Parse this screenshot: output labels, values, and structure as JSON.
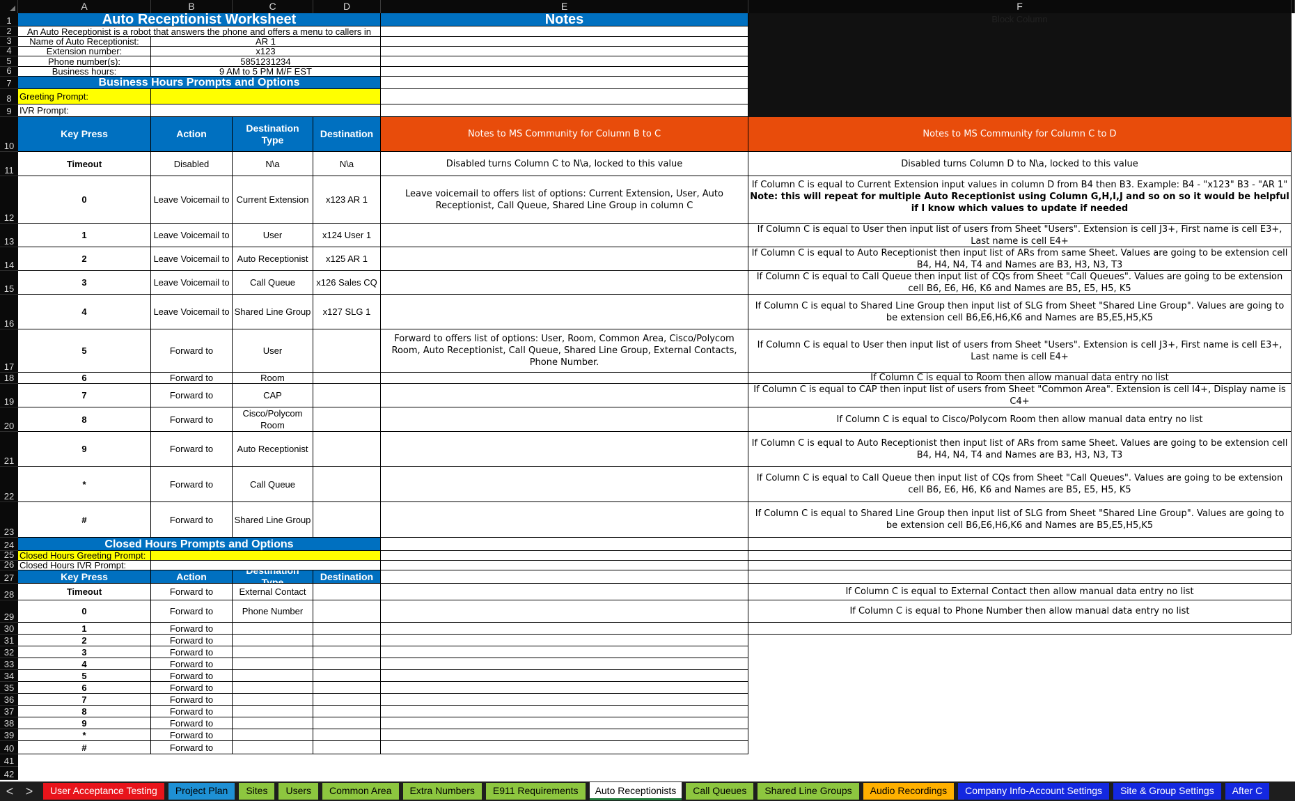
{
  "columns": [
    "A",
    "B",
    "C",
    "D",
    "E",
    "F"
  ],
  "rows": [
    "1",
    "2",
    "3",
    "4",
    "5",
    "6",
    "7",
    "8",
    "9",
    "10",
    "11",
    "12",
    "13",
    "14",
    "15",
    "16",
    "17",
    "18",
    "19",
    "20",
    "21",
    "22",
    "23",
    "24",
    "25",
    "26",
    "27",
    "28",
    "29",
    "30",
    "31",
    "32",
    "33",
    "34",
    "35",
    "36",
    "37",
    "38",
    "39",
    "40",
    "41",
    "42"
  ],
  "header": {
    "title": "Auto Receptionist Worksheet",
    "notes_title": "Notes",
    "block_column": "Block Column",
    "description": "An Auto Receptionist is a robot that answers the phone and offers a menu to callers in"
  },
  "info": [
    {
      "label": "Name of Auto Receptionist:",
      "value": "AR 1"
    },
    {
      "label": "Extension number:",
      "value": "x123"
    },
    {
      "label": "Phone number(s):",
      "value": "5851231234"
    },
    {
      "label": "Business hours:",
      "value": "9 AM to 5 PM M/F EST"
    }
  ],
  "business": {
    "section_title": "Business Hours Prompts and Options",
    "greeting_label": "Greeting Prompt:",
    "ivr_label": "IVR Prompt:",
    "col_key": "Key Press",
    "col_action": "Action",
    "col_dest_type": "Destination Type",
    "col_dest": "Destination",
    "notes_bc": "Notes to MS Community for Column B to C",
    "notes_cd": "Notes to MS Community for Column C to D",
    "rows": [
      {
        "key": "Timeout",
        "action": "Disabled",
        "type": "N\\a",
        "dest": "N\\a",
        "note_e": "Disabled turns Column C to N\\a, locked to this value",
        "note_f": "Disabled turns Column D to N\\a, locked to this value",
        "note_f_bold": ""
      },
      {
        "key": "0",
        "action": "Leave Voicemail to",
        "type": "Current Extension",
        "dest": "x123 AR 1",
        "note_e": "Leave voicemail to offers list of options: Current Extension, User, Auto Receptionist, Call Queue, Shared Line Group in column C",
        "note_f": "If Column C is equal to Current Extension input values in column D from B4 then B3. Example: B4 - \"x123\" B3 - \"AR 1\"",
        "note_f_bold": "Note: this will repeat for multiple Auto Receptionist using Column G,H,I,J and so on so it would be helpful if I know which values to update if needed"
      },
      {
        "key": "1",
        "action": "Leave Voicemail to",
        "type": "User",
        "dest": "x124 User 1",
        "note_e": "",
        "note_f": "If Column C is equal to User then input list of users from Sheet \"Users\". Extension is cell J3+, First name is cell E3+, Last name is cell E4+",
        "note_f_bold": ""
      },
      {
        "key": "2",
        "action": "Leave Voicemail to",
        "type": "Auto Receptionist",
        "dest": "x125 AR 1",
        "note_e": "",
        "note_f": "If Column C is equal to Auto Receptionist then input list of ARs from same Sheet. Values are going to be extension cell B4, H4, N4, T4 and Names are B3, H3, N3, T3",
        "note_f_bold": ""
      },
      {
        "key": "3",
        "action": "Leave Voicemail to",
        "type": "Call Queue",
        "dest": "x126 Sales CQ",
        "note_e": "",
        "note_f": "If Column C is equal to Call Queue then input list of CQs from Sheet \"Call Queues\". Values are going to be extension cell B6, E6, H6, K6 and Names are B5, E5, H5, K5",
        "note_f_bold": ""
      },
      {
        "key": "4",
        "action": "Leave Voicemail to",
        "type": "Shared Line Group",
        "dest": "x127 SLG 1",
        "note_e": "",
        "note_f": "If Column C is equal to Shared Line Group then input list of SLG from Sheet \"Shared Line Group\". Values are going to be extension cell B6,E6,H6,K6 and Names are B5,E5,H5,K5",
        "note_f_bold": ""
      },
      {
        "key": "5",
        "action": "Forward to",
        "type": "User",
        "dest": "",
        "note_e": "Forward to offers list of options: User, Room, Common Area, Cisco/Polycom Room, Auto Receptionist, Call Queue, Shared Line Group, External Contacts, Phone Number.",
        "note_f": "If Column C is equal to User then input list of users from Sheet \"Users\". Extension is cell J3+, First name is cell E3+, Last name is cell E4+",
        "note_f_bold": ""
      },
      {
        "key": "6",
        "action": "Forward to",
        "type": "Room",
        "dest": "",
        "note_e": "",
        "note_f": "If Column C is equal to Room then allow manual data entry no list",
        "note_f_bold": ""
      },
      {
        "key": "7",
        "action": "Forward to",
        "type": "CAP",
        "dest": "",
        "note_e": "",
        "note_f": "If Column C is equal to CAP then input list of users from Sheet \"Common Area\". Extension is cell I4+, Display name is C4+",
        "note_f_bold": ""
      },
      {
        "key": "8",
        "action": "Forward to",
        "type": "Cisco/Polycom Room",
        "dest": "",
        "note_e": "",
        "note_f": "If Column C is equal to Cisco/Polycom Room then allow manual data entry no list",
        "note_f_bold": ""
      },
      {
        "key": "9",
        "action": "Forward to",
        "type": "Auto Receptionist",
        "dest": "",
        "note_e": "",
        "note_f": "If Column C is equal to Auto Receptionist then input list of ARs from same Sheet. Values are going to be extension cell B4, H4, N4, T4 and Names are B3, H3, N3, T3",
        "note_f_bold": ""
      },
      {
        "key": "*",
        "action": "Forward to",
        "type": "Call Queue",
        "dest": "",
        "note_e": "",
        "note_f": "If Column C is equal to Call Queue then input list of CQs from Sheet \"Call Queues\". Values are going to be extension cell B6, E6, H6, K6 and Names are B5, E5, H5, K5",
        "note_f_bold": ""
      },
      {
        "key": "#",
        "action": "Forward to",
        "type": "Shared Line Group",
        "dest": "",
        "note_e": "",
        "note_f": "If Column C is equal to Shared Line Group then input list of SLG from Sheet \"Shared Line Group\". Values are going to be extension cell B6,E6,H6,K6 and Names are B5,E5,H5,K5",
        "note_f_bold": ""
      }
    ]
  },
  "closed": {
    "section_title": "Closed Hours Prompts and Options",
    "greeting_label": "Closed Hours Greeting Prompt:",
    "ivr_label": "Closed Hours IVR Prompt:",
    "col_key": "Key Press",
    "col_action": "Action",
    "col_dest_type": "Destination Type",
    "col_dest": "Destination",
    "rows": [
      {
        "key": "Timeout",
        "action": "Forward to",
        "type": "External Contact",
        "note_f": "If Column C is equal to External Contact then allow manual data entry no list"
      },
      {
        "key": "0",
        "action": "Forward to",
        "type": "Phone Number",
        "note_f": "If Column C is equal to Phone Number then allow manual data entry no list"
      },
      {
        "key": "1",
        "action": "Forward to",
        "type": "",
        "note_f": ""
      },
      {
        "key": "2",
        "action": "Forward to",
        "type": "",
        "note_f": ""
      },
      {
        "key": "3",
        "action": "Forward to",
        "type": "",
        "note_f": ""
      },
      {
        "key": "4",
        "action": "Forward to",
        "type": "",
        "note_f": ""
      },
      {
        "key": "5",
        "action": "Forward to",
        "type": "",
        "note_f": ""
      },
      {
        "key": "6",
        "action": "Forward to",
        "type": "",
        "note_f": ""
      },
      {
        "key": "7",
        "action": "Forward to",
        "type": "",
        "note_f": ""
      },
      {
        "key": "8",
        "action": "Forward to",
        "type": "",
        "note_f": ""
      },
      {
        "key": "9",
        "action": "Forward to",
        "type": "",
        "note_f": ""
      },
      {
        "key": "*",
        "action": "Forward to",
        "type": "",
        "note_f": ""
      },
      {
        "key": "#",
        "action": "Forward to",
        "type": "",
        "note_f": ""
      }
    ]
  },
  "tabs": [
    {
      "label": "User Acceptance Testing",
      "bg": "#e8141b",
      "fg": "#ffffff"
    },
    {
      "label": "Project Plan",
      "bg": "#1e90d4",
      "fg": "#000000"
    },
    {
      "label": "Sites",
      "bg": "#8dc63f",
      "fg": "#000000"
    },
    {
      "label": "Users",
      "bg": "#8dc63f",
      "fg": "#000000"
    },
    {
      "label": "Common Area",
      "bg": "#8dc63f",
      "fg": "#000000"
    },
    {
      "label": "Extra Numbers",
      "bg": "#8dc63f",
      "fg": "#000000"
    },
    {
      "label": "E911 Requirements",
      "bg": "#8dc63f",
      "fg": "#000000"
    },
    {
      "label": "Auto Receptionists",
      "bg": "#ffffff",
      "fg": "#000000",
      "active": true
    },
    {
      "label": "Call Queues",
      "bg": "#8dc63f",
      "fg": "#000000"
    },
    {
      "label": "Shared Line Groups",
      "bg": "#8dc63f",
      "fg": "#000000"
    },
    {
      "label": "Audio Recordings",
      "bg": "#ffb000",
      "fg": "#000000"
    },
    {
      "label": "Company Info-Account Settings",
      "bg": "#1428e0",
      "fg": "#ffffff"
    },
    {
      "label": "Site & Group Settings",
      "bg": "#1428e0",
      "fg": "#ffffff"
    },
    {
      "label": "After C",
      "bg": "#1428e0",
      "fg": "#ffffff"
    }
  ],
  "nav": {
    "prev": "<",
    "next": ">"
  }
}
